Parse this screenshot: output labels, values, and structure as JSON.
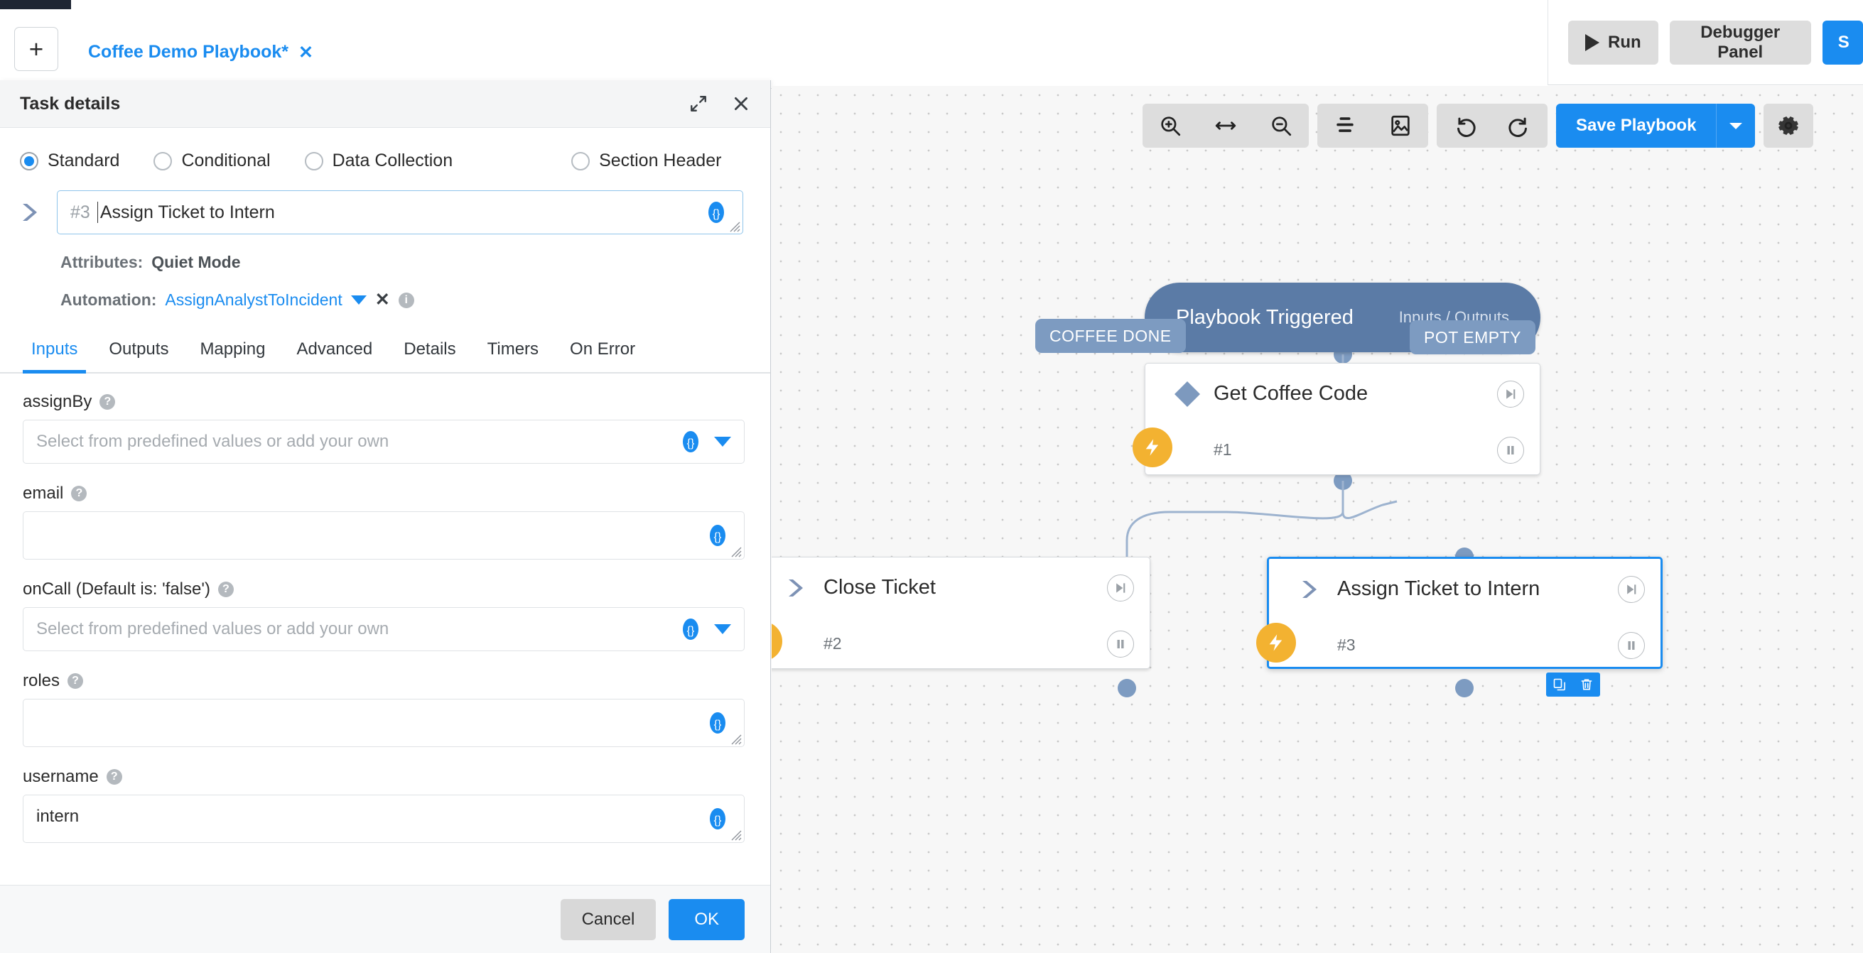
{
  "tabbar": {
    "add_label": "+",
    "tab_label": "Coffee Demo Playbook*",
    "tab_close": "✕"
  },
  "top_actions": {
    "run_label": "Run",
    "debugger_label": "Debugger Panel",
    "save_partial_label": "S"
  },
  "panel": {
    "title": "Task details",
    "expand_icon": "expand-icon",
    "close_icon": "close-icon",
    "task_types": [
      {
        "label": "Standard",
        "selected": true
      },
      {
        "label": "Conditional",
        "selected": false
      },
      {
        "label": "Data Collection",
        "selected": false
      },
      {
        "label": "Section Header",
        "selected": false
      }
    ],
    "task_number": "#3",
    "task_name": "Assign Ticket to Intern",
    "attributes_label": "Attributes:",
    "attributes_value": "Quiet Mode",
    "automation_label": "Automation:",
    "automation_value": "AssignAnalystToIncident",
    "automation_clear": "✕",
    "tabs": [
      {
        "label": "Inputs",
        "active": true
      },
      {
        "label": "Outputs",
        "active": false
      },
      {
        "label": "Mapping",
        "active": false
      },
      {
        "label": "Advanced",
        "active": false
      },
      {
        "label": "Details",
        "active": false
      },
      {
        "label": "Timers",
        "active": false
      },
      {
        "label": "On Error",
        "active": false
      }
    ],
    "fields": [
      {
        "label": "assignBy",
        "placeholder": "Select from predefined values or add your own",
        "value": "",
        "type": "select"
      },
      {
        "label": "email",
        "placeholder": "",
        "value": "",
        "type": "textarea"
      },
      {
        "label": "onCall (Default is: 'false')",
        "placeholder": "Select from predefined values or add your own",
        "value": "",
        "type": "select"
      },
      {
        "label": "roles",
        "placeholder": "",
        "value": "",
        "type": "textarea"
      },
      {
        "label": "username",
        "placeholder": "",
        "value": "intern",
        "type": "textarea"
      }
    ],
    "cancel_label": "Cancel",
    "ok_label": "OK"
  },
  "canvas": {
    "toolbar": [
      {
        "name": "zoom-in-icon"
      },
      {
        "name": "fit-width-icon"
      },
      {
        "name": "zoom-out-icon"
      },
      {
        "name": "align-icon"
      },
      {
        "name": "snapshot-icon"
      },
      {
        "name": "undo-icon"
      },
      {
        "name": "redo-icon"
      }
    ],
    "save_playbook_label": "Save Playbook",
    "gear_icon": "gear-icon",
    "nodes": [
      {
        "id": "trigger",
        "title": "Playbook Triggered",
        "sub": "Inputs / Outputs",
        "type": "trigger"
      },
      {
        "id": "n1",
        "title": "Get Coffee Code",
        "number": "#1",
        "type": "condition",
        "selected": false
      },
      {
        "id": "n2",
        "title": "Close Ticket",
        "number": "#2",
        "type": "standard",
        "selected": false
      },
      {
        "id": "n3",
        "title": "Assign Ticket to Intern",
        "number": "#3",
        "type": "standard",
        "selected": true
      }
    ],
    "edge_labels": [
      {
        "text": "COFFEE DONE"
      },
      {
        "text": "POT EMPTY"
      }
    ],
    "node_actions": [
      {
        "name": "copy-icon"
      },
      {
        "name": "delete-icon"
      }
    ]
  },
  "colors": {
    "accent": "#1a8cf0",
    "node_blue": "#5b7ba6",
    "edge_label": "#7d9bc1",
    "bolt": "#f3b231"
  }
}
